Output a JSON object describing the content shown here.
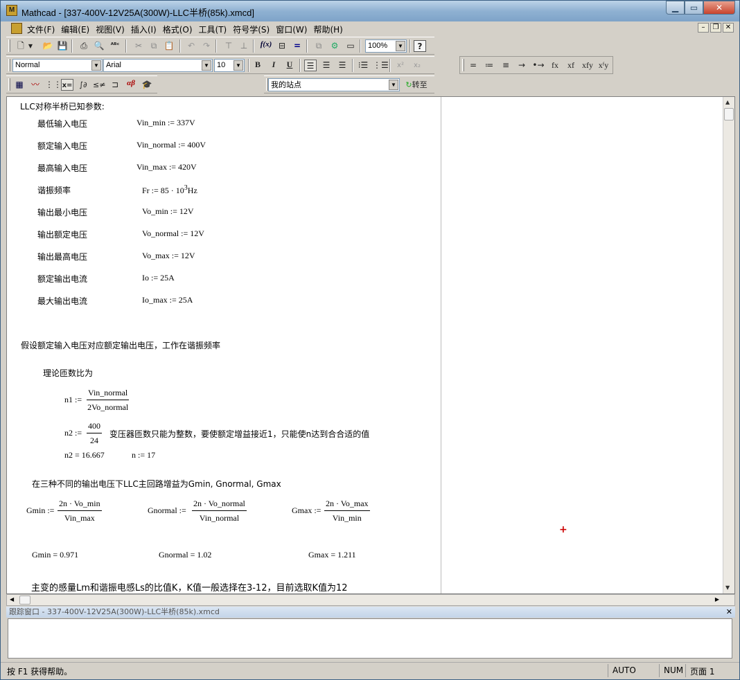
{
  "window": {
    "title": "Mathcad - [337-400V-12V25A(300W)-LLC半桥(85k).xmcd]"
  },
  "menu": [
    "文件(F)",
    "编辑(E)",
    "视图(V)",
    "插入(I)",
    "格式(O)",
    "工具(T)",
    "符号学(S)",
    "窗口(W)",
    "帮助(H)"
  ],
  "toolbar": {
    "zoom": "100%",
    "style": "Normal",
    "font": "Arial",
    "size": "10",
    "bold": "B",
    "italic": "I",
    "underline": "U",
    "site": "我的站点",
    "goto": "转至",
    "superscript": "x²",
    "subscript": "x₂"
  },
  "evaluation_toolbar": [
    "=",
    "≔",
    "≡",
    "→",
    "•→",
    "fx",
    "xf",
    "xfy",
    "xᶠy"
  ],
  "document": {
    "heading": "LLC对称半桥已知参数:",
    "params": [
      {
        "label": "最低输入电压",
        "expr": "Vin_min := 337V"
      },
      {
        "label": "额定输入电压",
        "expr": "Vin_normal := 400V"
      },
      {
        "label": "最高输入电压",
        "expr": "Vin_max := 420V"
      },
      {
        "label": "谐振频率",
        "expr": "Fr := 85 · 10",
        "sup": "3",
        "unit": "Hz"
      },
      {
        "label": "输出最小电压",
        "expr": "Vo_min := 12V"
      },
      {
        "label": "输出额定电压",
        "expr": "Vo_normal := 12V"
      },
      {
        "label": "输出最高电压",
        "expr": "Vo_max := 12V"
      },
      {
        "label": "额定输出电流",
        "expr": "Io := 25A"
      },
      {
        "label": "最大输出电流",
        "expr": "Io_max := 25A"
      }
    ],
    "assumption": "假设额定输入电压对应额定输出电压，工作在谐振频率",
    "turns_title": "理论匝数比为",
    "n1_lhs": "n1 :=",
    "n1_num": "Vin_normal",
    "n1_den": "2Vo_normal",
    "n2_lhs": "n2 :=",
    "n2_num": "400",
    "n2_den": "24",
    "n2_note": "变压器匝数只能为整数，要使额定增益接近1，只能使n达到合合适的值",
    "n2_result": "n2 = 16.667",
    "n_def": "n := 17",
    "gain_title": "在三种不同的输出电压下LLC主回路增益为Gmin, Gnormal, Gmax",
    "gmin_lhs": "Gmin :=",
    "gmin_num": "2n · Vo_min",
    "gmin_den": "Vin_max",
    "gnormal_lhs": "Gnormal :=",
    "gnormal_num": "2n · Vo_normal",
    "gnormal_den": "Vin_normal",
    "gmax_lhs": "Gmax :=",
    "gmax_num": "2n · Vo_max",
    "gmax_den": "Vin_min",
    "gmin_result": "Gmin = 0.971",
    "gnormal_result": "Gnormal = 1.02",
    "gmax_result": "Gmax = 1.211",
    "k_text": "主变的感量Lm和谐振电感Ls的比值K，K值一般选择在3-12，目前选取K值为12"
  },
  "trace_window": {
    "title": "跟踪窗口 - 337-400V-12V25A(300W)-LLC半桥(85k).xmcd"
  },
  "status": {
    "help": "按 F1 获得帮助。",
    "auto": "AUTO",
    "num": "NUM",
    "page": "页面 1"
  }
}
